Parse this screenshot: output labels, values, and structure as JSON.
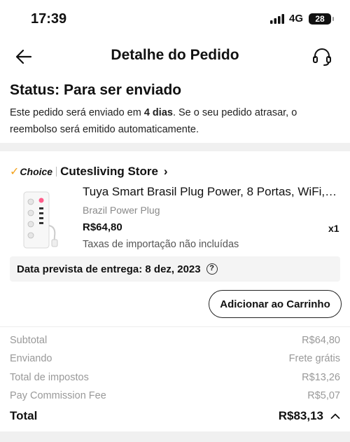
{
  "status_bar": {
    "time": "17:39",
    "network": "4G",
    "battery": "28"
  },
  "nav": {
    "title": "Detalhe do Pedido"
  },
  "order_status": {
    "title": "Status: Para ser enviado",
    "desc_prefix": "Este pedido será enviado em ",
    "desc_bold": "4 dias",
    "desc_suffix": ". Se o seu pedido atrasar, o reembolso será emitido automaticamente."
  },
  "store": {
    "badge": "Choice",
    "name": "Cutesliving Store"
  },
  "product": {
    "title": "Tuya Smart Brasil Plug Power, 8 Portas, WiFi,…",
    "variant": "Brazil Power Plug",
    "price": "R$64,80",
    "quantity": "x1",
    "tax_note": "Taxas de importação não incluídas"
  },
  "delivery": {
    "text": "Data prevista de entrega: 8 dez, 2023",
    "info_glyph": "?"
  },
  "actions": {
    "add_to_cart": "Adicionar ao Carrinho"
  },
  "summary": {
    "rows": [
      {
        "label": "Subtotal",
        "value": "R$64,80"
      },
      {
        "label": "Enviando",
        "value": "Frete grátis"
      },
      {
        "label": "Total de impostos",
        "value": "R$13,26"
      },
      {
        "label": "Pay Commission Fee",
        "value": "R$5,07"
      }
    ],
    "total_label": "Total",
    "total_value": "R$83,13"
  },
  "colors": {
    "choice_accent": "#f3a21b",
    "section_band": "#f0f0f0",
    "muted_text": "#999999"
  },
  "icons": {
    "back": "arrow-left-icon",
    "support": "headset-icon",
    "store_chevron": "chevron-right-icon",
    "total_toggle": "chevron-up-icon",
    "delivery_info": "question-circle-icon"
  }
}
